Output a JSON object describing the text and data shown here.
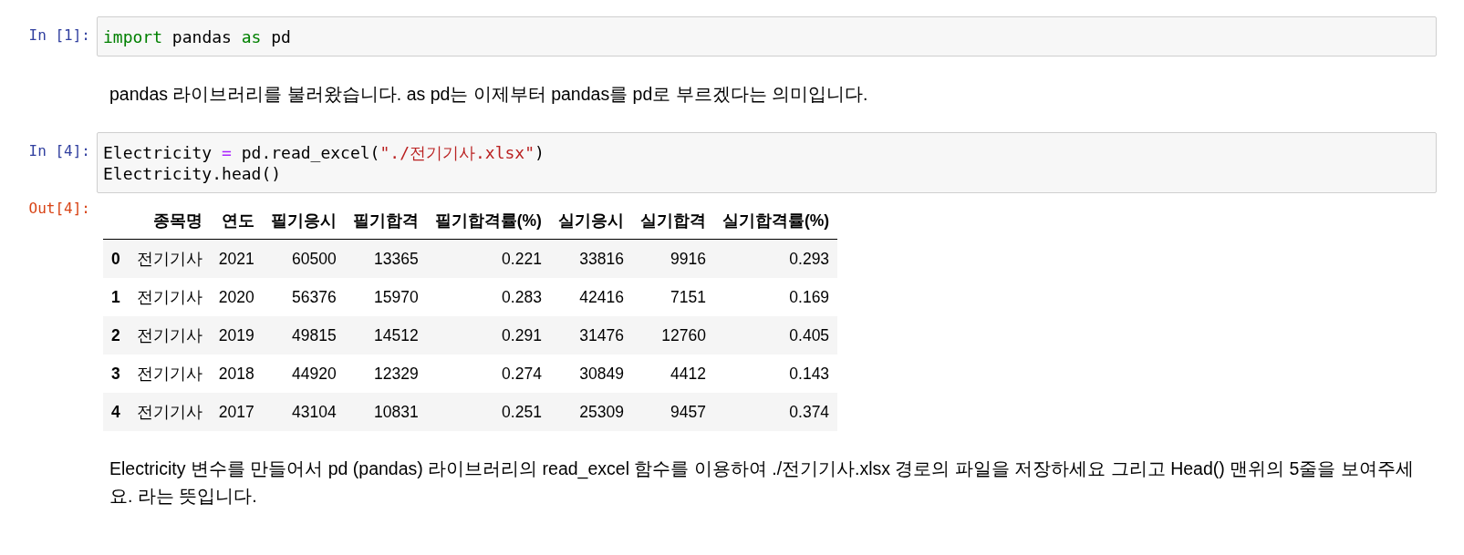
{
  "cells": [
    {
      "kind": "code",
      "prompt": "In [1]:",
      "lines": [
        [
          {
            "kind": "keyword",
            "text": "import"
          },
          {
            "kind": "plain",
            "text": " pandas "
          },
          {
            "kind": "keyword",
            "text": "as"
          },
          {
            "kind": "plain",
            "text": " pd"
          }
        ]
      ]
    },
    {
      "kind": "markdown",
      "text": "pandas 라이브러리를 불러왔습니다. as pd는 이제부터 pandas를 pd로 부르겠다는 의미입니다."
    },
    {
      "kind": "code",
      "prompt": "In [4]:",
      "lines": [
        [
          {
            "kind": "plain",
            "text": "Electricity "
          },
          {
            "kind": "operator",
            "text": "="
          },
          {
            "kind": "plain",
            "text": " pd.read_excel("
          },
          {
            "kind": "string",
            "text": "\"./전기기사.xlsx\""
          },
          {
            "kind": "plain",
            "text": ")"
          }
        ],
        [
          {
            "kind": "plain",
            "text": "Electricity.head()"
          }
        ]
      ]
    },
    {
      "kind": "output",
      "prompt": "Out[4]:",
      "table": {
        "columns": [
          "종목명",
          "연도",
          "필기응시",
          "필기합격",
          "필기합격률(%)",
          "실기응시",
          "실기합격",
          "실기합격률(%)"
        ],
        "rows": [
          {
            "index": "0",
            "cells": [
              "전기기사",
              "2021",
              "60500",
              "13365",
              "0.221",
              "33816",
              "9916",
              "0.293"
            ]
          },
          {
            "index": "1",
            "cells": [
              "전기기사",
              "2020",
              "56376",
              "15970",
              "0.283",
              "42416",
              "7151",
              "0.169"
            ]
          },
          {
            "index": "2",
            "cells": [
              "전기기사",
              "2019",
              "49815",
              "14512",
              "0.291",
              "31476",
              "12760",
              "0.405"
            ]
          },
          {
            "index": "3",
            "cells": [
              "전기기사",
              "2018",
              "44920",
              "12329",
              "0.274",
              "30849",
              "4412",
              "0.143"
            ]
          },
          {
            "index": "4",
            "cells": [
              "전기기사",
              "2017",
              "43104",
              "10831",
              "0.251",
              "25309",
              "9457",
              "0.374"
            ]
          }
        ]
      }
    },
    {
      "kind": "markdown",
      "text": "Electricity 변수를 만들어서 pd (pandas) 라이브러리의 read_excel 함수를 이용하여 ./전기기사.xlsx 경로의 파일을 저장하세요 그리고 Head() 맨위의 5줄을 보여주세요. 라는 뜻입니다."
    }
  ]
}
